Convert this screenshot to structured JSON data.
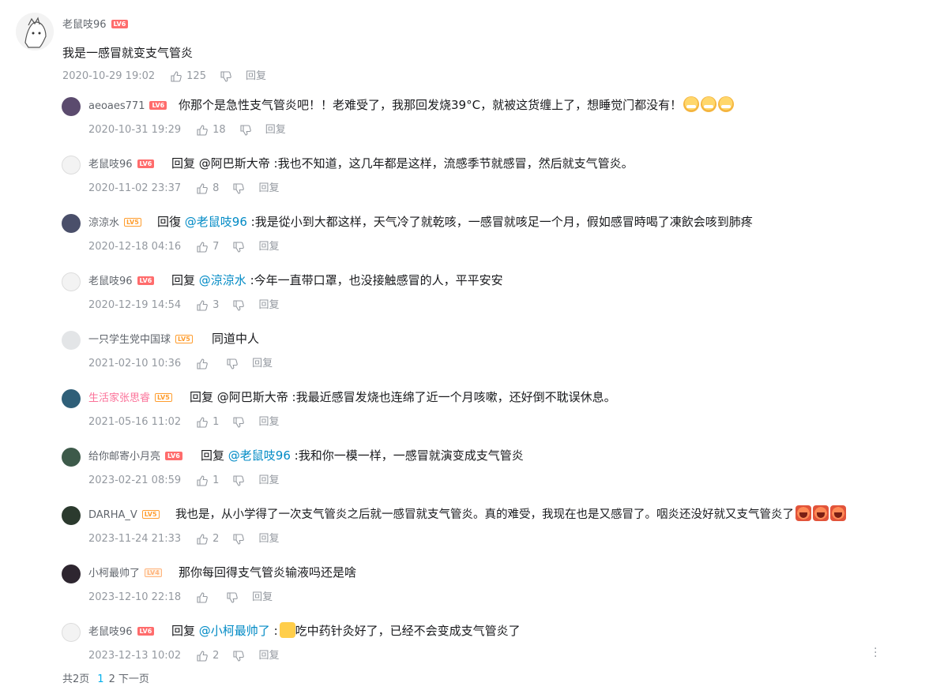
{
  "root": {
    "user": "老鼠吱96",
    "level": "LV6",
    "content": "我是一感冒就变支气管炎",
    "time": "2020-10-29 19:02",
    "likes": "125",
    "reply_label": "回复"
  },
  "replies": [
    {
      "user": "aeoaes771",
      "level": "LV6",
      "prefix": "你那个是急性支气管炎吧！！老难受了，我那回发烧39°C，就被这货缠上了，想睡觉门都没有！",
      "mention": "",
      "text": "",
      "time": "2020-10-31 19:29",
      "likes": "18",
      "reply_label": "回复"
    },
    {
      "user": "老鼠吱96",
      "level": "LV6",
      "prefix": "回复 @阿巴斯大帝 :我也不知道，这几年都是这样，流感季节就感冒，然后就支气管炎。",
      "mention": "",
      "text": "",
      "time": "2020-11-02 23:37",
      "likes": "8",
      "reply_label": "回复"
    },
    {
      "user": "涼涼水",
      "level": "LV5",
      "prefix": "回復 ",
      "mention": "@老鼠吱96",
      "text": " :我是從小到大都这样，天气冷了就乾咳，一感冒就咳足一个月，假如感冒時喝了凍飲会咳到肺疼",
      "time": "2020-12-18 04:16",
      "likes": "7",
      "reply_label": "回复"
    },
    {
      "user": "老鼠吱96",
      "level": "LV6",
      "prefix": "回复 ",
      "mention": "@涼涼水",
      "text": " :今年一直带口罩，也没接触感冒的人，平平安安",
      "time": "2020-12-19 14:54",
      "likes": "3",
      "reply_label": "回复"
    },
    {
      "user": "一只学生党中国球",
      "level": "LV5",
      "prefix": "同道中人",
      "mention": "",
      "text": "",
      "time": "2021-02-10 10:36",
      "likes": "",
      "reply_label": "回复"
    },
    {
      "user": "生活家张思睿",
      "level": "LV5",
      "prefix": "回复 @阿巴斯大帝 :我最近感冒发烧也连绵了近一个月咳嗽，还好倒不耽误休息。",
      "mention": "",
      "text": "",
      "time": "2021-05-16 11:02",
      "likes": "1",
      "reply_label": "回复"
    },
    {
      "user": "给你邮寄小月亮",
      "level": "LV6",
      "prefix": "回复 ",
      "mention": "@老鼠吱96",
      "text": " :我和你一模一样，一感冒就演变成支气管炎",
      "time": "2023-02-21 08:59",
      "likes": "1",
      "reply_label": "回复"
    },
    {
      "user": "DARHA_V",
      "level": "LV5",
      "prefix": "我也是，从小学得了一次支气管炎之后就一感冒就支气管炎。真的难受，我现在也是又感冒了。咽炎还没好就又支气管炎了",
      "mention": "",
      "text": "",
      "time": "2023-11-24 21:33",
      "likes": "2",
      "reply_label": "回复"
    },
    {
      "user": "小柯最帅了",
      "level": "LV4",
      "prefix": "那你每回得支气管炎输液吗还是啥",
      "mention": "",
      "text": "",
      "time": "2023-12-10 22:18",
      "likes": "",
      "reply_label": "回复"
    },
    {
      "user": "老鼠吱96",
      "level": "LV6",
      "prefix": "回复 ",
      "mention": "@小柯最帅了",
      "text": " :",
      "text2": "吃中药针灸好了，已经不会变成支气管炎了",
      "time": "2023-12-13 10:02",
      "likes": "2",
      "reply_label": "回复"
    }
  ],
  "pager": {
    "total": "共2页",
    "page1": "1",
    "page2": "2",
    "next": "下一页"
  },
  "colors": {
    "mention": "#008ac5",
    "meta": "#9499a0",
    "pink_name": "#fb7299"
  }
}
